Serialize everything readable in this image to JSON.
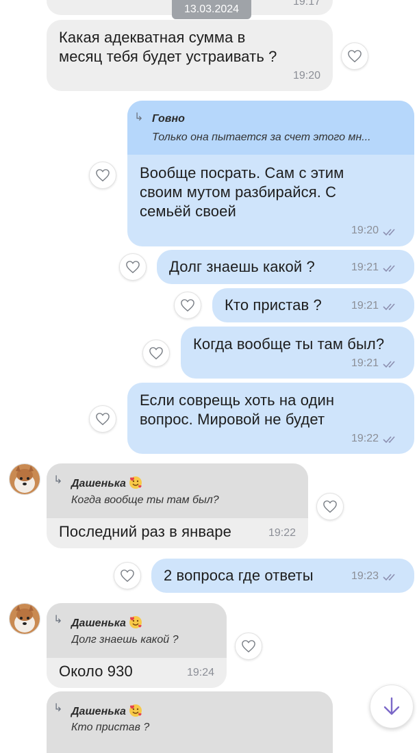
{
  "date_badge": "13.03.2024",
  "top_cut_time": "19:17",
  "colors": {
    "outgoing_bubble": "#cfe4fb",
    "incoming_bubble": "#eeeeee",
    "tick_color": "#8c8fb0",
    "accent": "#7b68c8"
  },
  "messages": [
    {
      "id": 1,
      "direction": "in",
      "text_lines": [
        "Какая адекватная  сумма в",
        "месяц тебя будет устраивать ?"
      ],
      "time": "19:20"
    },
    {
      "id": 2,
      "direction": "out",
      "reply": {
        "name": "Говно",
        "text": "Только она пытается за счет этого мн..."
      },
      "text_lines": [
        "Вообще посрать.  Сам с этим",
        "своим мутом разбирайся. С",
        "семьёй своей"
      ],
      "time": "19:20"
    },
    {
      "id": 3,
      "direction": "out",
      "text": "Долг знаешь какой ?",
      "time": "19:21"
    },
    {
      "id": 4,
      "direction": "out",
      "text": "Кто пристав ?",
      "time": "19:21"
    },
    {
      "id": 5,
      "direction": "out",
      "text": "Когда вообще ты там был?",
      "time": "19:21"
    },
    {
      "id": 6,
      "direction": "out",
      "text_lines": [
        "Если соврещь хоть на один",
        "вопрос. Мировой не будет"
      ],
      "time": "19:22"
    },
    {
      "id": 7,
      "direction": "in",
      "reply": {
        "name": "Дашенька",
        "text": "Когда вообще ты там был?"
      },
      "text": "Последний раз в январе",
      "time": "19:22"
    },
    {
      "id": 8,
      "direction": "out",
      "text": "2 вопроса где ответы",
      "time": "19:23"
    },
    {
      "id": 9,
      "direction": "in",
      "reply": {
        "name": "Дашенька",
        "text": "Долг знаешь какой ?"
      },
      "text": "Около 930",
      "time": "19:24"
    },
    {
      "id": 10,
      "direction": "in",
      "reply": {
        "name": "Дашенька",
        "text": "Кто пристав ?"
      }
    }
  ],
  "icons": {
    "heart": "heart-outline-icon",
    "read": "double-check-icon",
    "reply": "reply-arrow-icon",
    "scroll": "arrow-down-icon",
    "emoji": "smiling-face-with-hearts-emoji"
  }
}
